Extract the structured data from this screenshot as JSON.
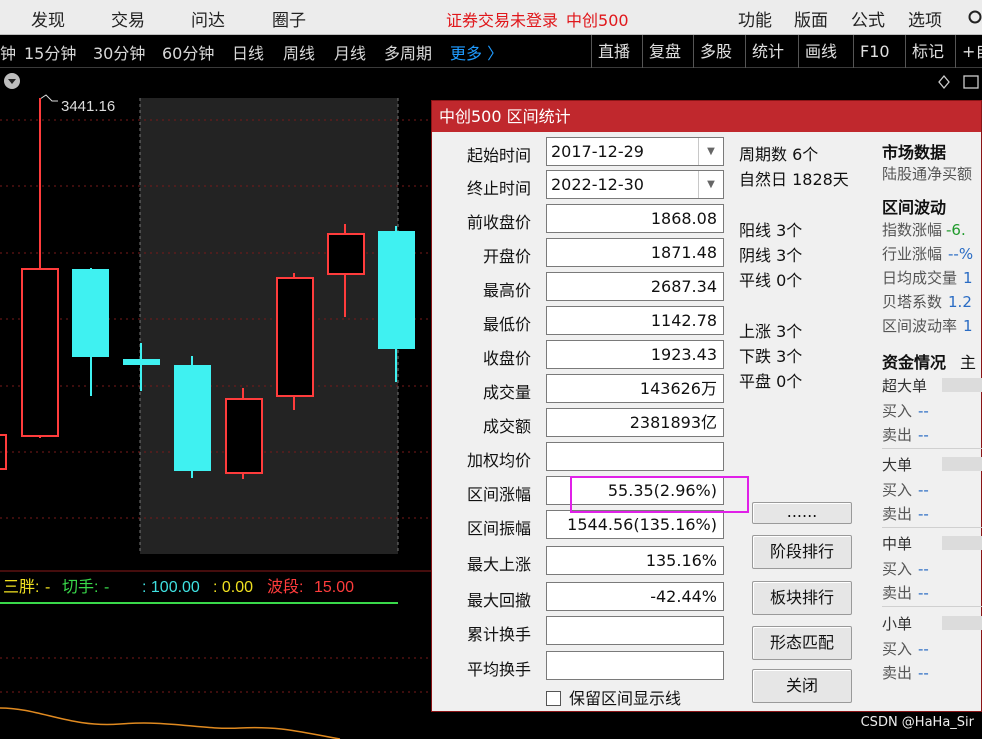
{
  "menu": {
    "items": [
      "发现",
      "交易",
      "问达",
      "圈子"
    ],
    "status": "证券交易未登录",
    "security": "中创500",
    "right_items": [
      "功能",
      "版面",
      "公式",
      "选项"
    ]
  },
  "toolbar": {
    "periods": [
      "钟",
      "15分钟",
      "30分钟",
      "60分钟",
      "日线",
      "周线",
      "月线",
      "多周期"
    ],
    "more": "更多 〉",
    "tools": [
      "直播",
      "复盘",
      "多股",
      "统计",
      "画线",
      "F10",
      "标记",
      "+自"
    ]
  },
  "chart": {
    "high_label": "3441.16",
    "indicator": {
      "name1": "三胖:",
      "v1": "-",
      "name2": "切手:",
      "v2": "-",
      "v3": ": 100.00",
      "v4": ": 0.00",
      "name5": "波段:",
      "v5": "15.00"
    }
  },
  "dialog": {
    "title": "中创500 区间统计",
    "start_label": "起始时间",
    "start_value": "2017-12-29",
    "end_label": "终止时间",
    "end_value": "2022-12-30",
    "fields": [
      {
        "label": "前收盘价",
        "value": "1868.08"
      },
      {
        "label": "开盘价",
        "value": "1871.48"
      },
      {
        "label": "最高价",
        "value": "2687.34"
      },
      {
        "label": "最低价",
        "value": "1142.78"
      },
      {
        "label": "收盘价",
        "value": "1923.43"
      },
      {
        "label": "成交量",
        "value": "143626万"
      },
      {
        "label": "成交额",
        "value": "2381893亿"
      },
      {
        "label": "加权均价",
        "value": ""
      },
      {
        "label": "区间涨幅",
        "value": "55.35(2.96%)"
      },
      {
        "label": "区间振幅",
        "value": "1544.56(135.16%)"
      },
      {
        "label": "最大上涨",
        "value": "135.16%"
      },
      {
        "label": "最大回撤",
        "value": "-42.44%"
      },
      {
        "label": "累计换手",
        "value": ""
      },
      {
        "label": "平均换手",
        "value": ""
      }
    ],
    "stats": {
      "periods": "周期数 6个",
      "natural_days": "自然日 1828天",
      "yang": "阳线 3个",
      "yin": "阴线 3个",
      "flat_line": "平线 0个",
      "up": "上涨 3个",
      "down": "下跌 3个",
      "flat": "平盘 0个"
    },
    "buttons": {
      "more": "......",
      "stage_rank": "阶段排行",
      "sector_rank": "板块排行",
      "pattern_match": "形态匹配",
      "close": "关闭"
    },
    "keep_line_label": "保留区间显示线",
    "market": {
      "title": "市场数据",
      "hsgt": "陆股通净买额"
    },
    "volatility": {
      "title": "区间波动",
      "rows": [
        {
          "label": "指数涨幅",
          "value": "-6."
        },
        {
          "label": "行业涨幅",
          "value": "--%"
        },
        {
          "label": "日均成交量",
          "value": "1"
        },
        {
          "label": "贝塔系数",
          "value": "1.2"
        },
        {
          "label": "区间波动率",
          "value": "1"
        }
      ]
    },
    "funds": {
      "title": "资金情况",
      "extra": "主",
      "groups": [
        {
          "name": "超大单",
          "buy": "买入",
          "buy_val": "--",
          "sell": "卖出",
          "sell_val": "--"
        },
        {
          "name": "大单",
          "buy": "买入",
          "buy_val": "--",
          "sell": "卖出",
          "sell_val": "--"
        },
        {
          "name": "中单",
          "buy": "买入",
          "buy_val": "--",
          "sell": "卖出",
          "sell_val": "--"
        },
        {
          "name": "小单",
          "buy": "买入",
          "buy_val": "--",
          "sell": "卖出",
          "sell_val": "--"
        }
      ]
    }
  },
  "watermark": "CSDN @HaHa_Sir",
  "colors": {
    "up": "#ff3c3c",
    "down": "#3ff1f1",
    "title_bar": "#c0282d",
    "highlight": "#e020e8"
  }
}
